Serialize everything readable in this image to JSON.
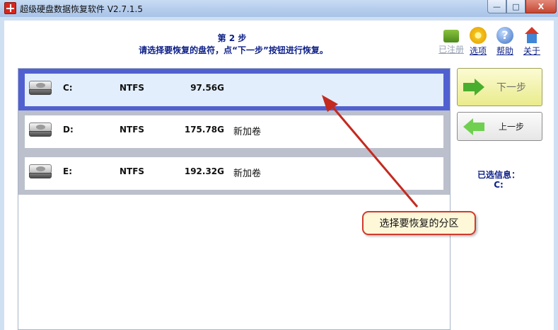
{
  "window": {
    "title": "超级硬盘数据恢复软件 V2.7.1.5",
    "min": "—",
    "max": "□",
    "close": "X"
  },
  "header": {
    "step": "第 2 步",
    "instruction": "请选择要恢复的盘符，点“下一步”按钮进行恢复。"
  },
  "toolbar": [
    {
      "label": "已注册",
      "icon": "cart-icon",
      "enabled": false
    },
    {
      "label": "选项",
      "icon": "gear-icon",
      "enabled": true
    },
    {
      "label": "帮助",
      "icon": "help-icon",
      "enabled": true
    },
    {
      "label": "关于",
      "icon": "home-icon",
      "enabled": true
    }
  ],
  "help_glyph": "?",
  "disks": [
    {
      "letter": "C:",
      "fs": "NTFS",
      "size": "97.56G",
      "label": "",
      "selected": true
    },
    {
      "letter": "D:",
      "fs": "NTFS",
      "size": "175.78G",
      "label": "新加卷",
      "selected": false
    },
    {
      "letter": "E:",
      "fs": "NTFS",
      "size": "192.32G",
      "label": "新加卷",
      "selected": false
    }
  ],
  "buttons": {
    "next": "下一步",
    "prev": "上一步"
  },
  "selected_info": {
    "title": "已选信息：",
    "value": "C:"
  },
  "callout": "选择要恢复的分区",
  "colors": {
    "accent": "#0c1f87",
    "selection_border": "#5160d0",
    "callout_border": "#d13a2d"
  }
}
